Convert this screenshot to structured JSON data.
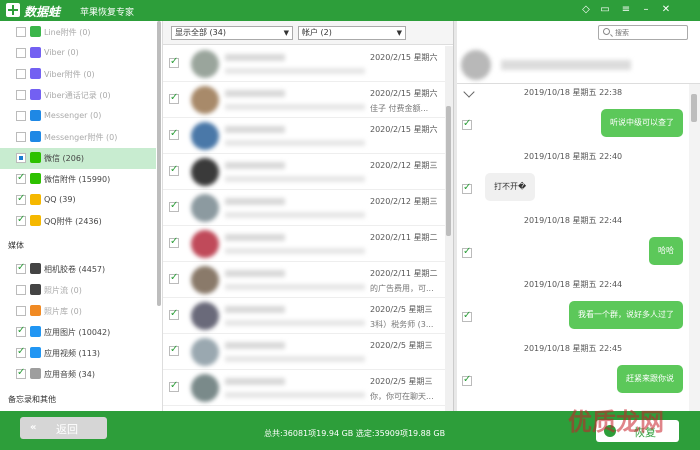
{
  "app": {
    "name": "数据蛙",
    "subtitle": "苹果恢复专家"
  },
  "sidebar": {
    "items": [
      {
        "label": "Line附件 (0)",
        "checked": false,
        "dim": true,
        "icon": "line-icon",
        "color": "#3bb54a"
      },
      {
        "label": "Viber (0)",
        "checked": false,
        "dim": true,
        "icon": "viber-icon",
        "color": "#7360f2"
      },
      {
        "label": "Viber附件 (0)",
        "checked": false,
        "dim": true,
        "icon": "viber-icon",
        "color": "#7360f2"
      },
      {
        "label": "Viber通话记录 (0)",
        "checked": false,
        "dim": true,
        "icon": "viber-icon",
        "color": "#7360f2"
      },
      {
        "label": "Messenger (0)",
        "checked": false,
        "dim": true,
        "icon": "messenger-icon",
        "color": "#1e88e5"
      },
      {
        "label": "Messenger附件 (0)",
        "checked": false,
        "dim": true,
        "icon": "messenger-icon",
        "color": "#1e88e5"
      },
      {
        "label": "微信 (206)",
        "checked": "partial",
        "dim": false,
        "active": true,
        "icon": "wechat-icon",
        "color": "#2dc100"
      },
      {
        "label": "微信附件 (15990)",
        "checked": true,
        "dim": false,
        "icon": "wechat-icon",
        "color": "#2dc100"
      },
      {
        "label": "QQ (39)",
        "checked": true,
        "dim": false,
        "icon": "qq-icon",
        "color": "#f5b800"
      },
      {
        "label": "QQ附件 (2436)",
        "checked": true,
        "dim": false,
        "icon": "qq-icon",
        "color": "#f5b800"
      }
    ],
    "media_heading": "媒体",
    "media_items": [
      {
        "label": "相机胶卷 (4457)",
        "checked": true,
        "dim": false,
        "icon": "camera-icon",
        "color": "#444444"
      },
      {
        "label": "照片流 (0)",
        "checked": false,
        "dim": true,
        "icon": "camera-icon",
        "color": "#444444"
      },
      {
        "label": "照片库 (0)",
        "checked": false,
        "dim": true,
        "icon": "photos-icon",
        "color": "#f08a24"
      },
      {
        "label": "应用图片 (10042)",
        "checked": true,
        "dim": false,
        "icon": "app-image-icon",
        "color": "#2196f3"
      },
      {
        "label": "应用视频 (113)",
        "checked": true,
        "dim": false,
        "icon": "app-video-icon",
        "color": "#2196f3"
      },
      {
        "label": "应用音频 (34)",
        "checked": true,
        "dim": false,
        "icon": "music-icon",
        "color": "#9e9e9e"
      }
    ],
    "memo_heading": "备忘录和其他"
  },
  "filters": {
    "show": "显示全部 (34)",
    "account": "帐户 (2)"
  },
  "search": {
    "placeholder": "搜索"
  },
  "conversations": [
    {
      "date": "2020/2/15 星期六",
      "snippet": "",
      "avatar_color": "#9aa59c"
    },
    {
      "date": "2020/2/15 星期六",
      "snippet": "佳子  付费金额...",
      "avatar_color": "#a88a6a"
    },
    {
      "date": "2020/2/15 星期六",
      "snippet": "",
      "avatar_color": "#4a78a8"
    },
    {
      "date": "2020/2/12 星期三",
      "snippet": "",
      "avatar_color": "#3a3a3a"
    },
    {
      "date": "2020/2/12 星期三",
      "snippet": "",
      "avatar_color": "#8c9aa0"
    },
    {
      "date": "2020/2/11 星期二",
      "snippet": "",
      "avatar_color": "#c04a5a"
    },
    {
      "date": "2020/2/11 星期二",
      "snippet": "的广告费用，可...",
      "avatar_color": "#8a7a6a"
    },
    {
      "date": "2020/2/5 星期三",
      "snippet": "3科）税务师 (3...",
      "avatar_color": "#6a6a7a"
    },
    {
      "date": "2020/2/5 星期三",
      "snippet": "",
      "avatar_color": "#9aa8b0"
    },
    {
      "date": "2020/2/5 星期三",
      "snippet": "你，你可在聊天...",
      "avatar_color": "#7a8a8a"
    }
  ],
  "messages": [
    {
      "timestamp": "2019/10/18 星期五 22:38",
      "text": "听说中级可以查了",
      "direction": "sent"
    },
    {
      "timestamp": "2019/10/18 星期五 22:40",
      "text": "打不开�",
      "direction": "received"
    },
    {
      "timestamp": "2019/10/18 星期五 22:44",
      "text": "哈哈",
      "direction": "sent"
    },
    {
      "timestamp": "2019/10/18 星期五 22:44",
      "text": "我看一个群，说好多人过了",
      "direction": "sent"
    },
    {
      "timestamp": "2019/10/18 星期五 22:45",
      "text": "赶紧来跟你说",
      "direction": "sent"
    }
  ],
  "bottom": {
    "back_label": "返回",
    "status": "总共:36081项19.94 GB 选定:35909项19.88 GB",
    "recover_label": "恢复"
  },
  "watermark": {
    "text": "优质龙网"
  },
  "colors": {
    "primary": "#2d9e3a",
    "sent_bubble": "#5cc85a",
    "active_row": "#c8ecd0"
  }
}
